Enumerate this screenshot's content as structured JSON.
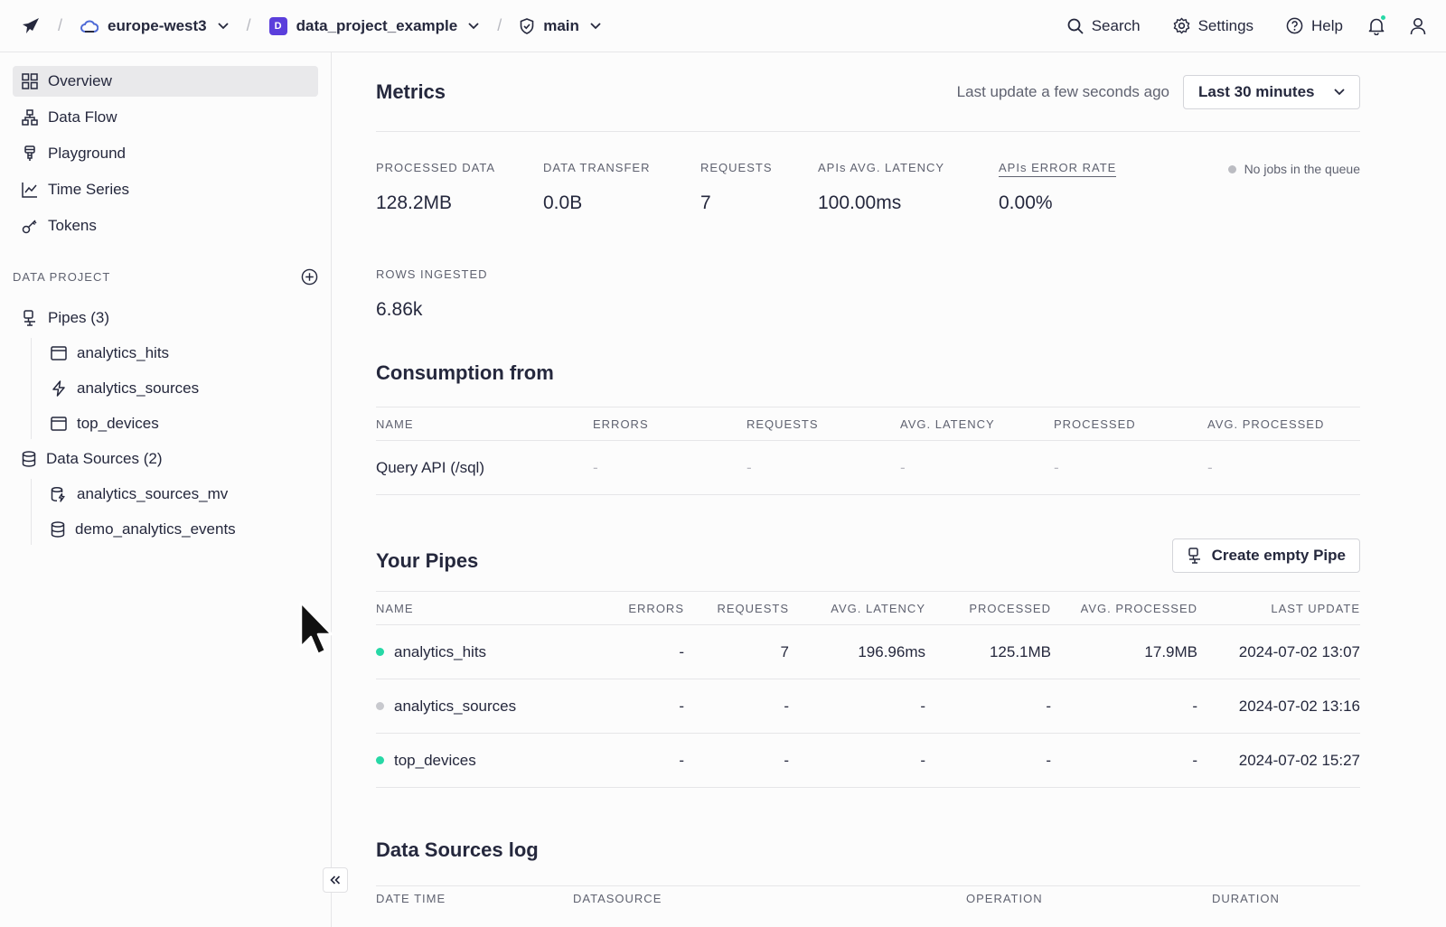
{
  "topbar": {
    "region": "europe-west3",
    "workspace_badge": "D",
    "workspace": "data_project_example",
    "branch": "main",
    "separator": "/",
    "search_label": "Search",
    "settings_label": "Settings",
    "help_label": "Help",
    "notification_color": "#27d8a6"
  },
  "sidebar": {
    "nav": [
      {
        "label": "Overview",
        "icon": "grid-icon",
        "active": true
      },
      {
        "label": "Data Flow",
        "icon": "hierarchy-icon"
      },
      {
        "label": "Playground",
        "icon": "playground-icon"
      },
      {
        "label": "Time Series",
        "icon": "chart-line-icon"
      },
      {
        "label": "Tokens",
        "icon": "key-icon"
      }
    ],
    "section_label": "DATA PROJECT",
    "pipes_label": "Pipes (3)",
    "pipes": [
      {
        "label": "analytics_hits",
        "icon": "endpoint-icon"
      },
      {
        "label": "analytics_sources",
        "icon": "bolt-icon"
      },
      {
        "label": "top_devices",
        "icon": "endpoint-icon"
      }
    ],
    "datasources_label": "Data Sources (2)",
    "datasources": [
      {
        "label": "analytics_sources_mv",
        "icon": "materialized-icon"
      },
      {
        "label": "demo_analytics_events",
        "icon": "database-icon"
      }
    ]
  },
  "metrics": {
    "title": "Metrics",
    "last_update": "Last update a few seconds ago",
    "range": "Last 30 minutes",
    "items": [
      {
        "label": "PROCESSED DATA",
        "value": "128.2MB"
      },
      {
        "label": "DATA TRANSFER",
        "value": "0.0B"
      },
      {
        "label": "REQUESTS",
        "value": "7"
      },
      {
        "label": "APIs AVG. LATENCY",
        "value": "100.00ms"
      },
      {
        "label": "APIs ERROR RATE",
        "value": "0.00%"
      }
    ],
    "rows_ingested_label": "ROWS INGESTED",
    "rows_ingested_value": "6.86k",
    "queue_status": "No jobs in the queue"
  },
  "consumption": {
    "title": "Consumption from",
    "columns": [
      "NAME",
      "ERRORS",
      "REQUESTS",
      "AVG. LATENCY",
      "PROCESSED",
      "AVG. PROCESSED"
    ],
    "rows": [
      [
        "Query API (/sql)",
        "-",
        "-",
        "-",
        "-",
        "-"
      ]
    ]
  },
  "pipes": {
    "title": "Your Pipes",
    "create_label": "Create empty Pipe",
    "columns": [
      "NAME",
      "ERRORS",
      "REQUESTS",
      "AVG. LATENCY",
      "PROCESSED",
      "AVG. PROCESSED",
      "LAST UPDATE"
    ],
    "rows": [
      {
        "name": "analytics_hits",
        "status_color": "#27d8a6",
        "errors": "-",
        "requests": "7",
        "latency": "196.96ms",
        "processed": "125.1MB",
        "avg_processed": "17.9MB",
        "last_update": "2024-07-02 13:07"
      },
      {
        "name": "analytics_sources",
        "status_color": "#c8c9ce",
        "errors": "-",
        "requests": "-",
        "latency": "-",
        "processed": "-",
        "avg_processed": "-",
        "last_update": "2024-07-02 13:16"
      },
      {
        "name": "top_devices",
        "status_color": "#27d8a6",
        "errors": "-",
        "requests": "-",
        "latency": "-",
        "processed": "-",
        "avg_processed": "-",
        "last_update": "2024-07-02 15:27"
      }
    ]
  },
  "datasources_log": {
    "title": "Data Sources log",
    "columns": [
      "DATE TIME",
      "DATASOURCE",
      "OPERATION",
      "DURATION"
    ]
  }
}
